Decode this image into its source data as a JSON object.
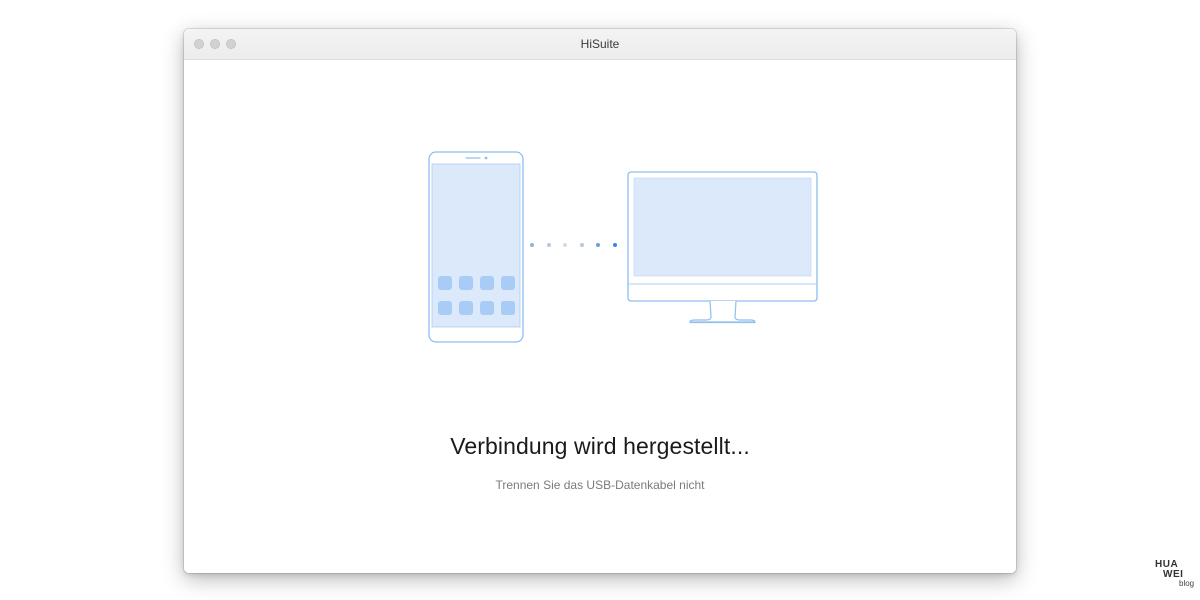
{
  "window": {
    "title": "HiSuite"
  },
  "connection": {
    "heading": "Verbindung wird hergestellt...",
    "subtext": "Trennen Sie das USB-Datenkabel nicht"
  },
  "illustration": {
    "left_icon": "phone-icon",
    "right_icon": "monitor-icon",
    "progress_dots": 6
  },
  "watermark": {
    "line1": "HUA",
    "line2": "WEI",
    "line3": "blog"
  },
  "colors": {
    "accent": "#3b82f6",
    "outline": "#8fbef0",
    "fill": "#dbe9fb",
    "app_tile": "#a8ccf5"
  }
}
